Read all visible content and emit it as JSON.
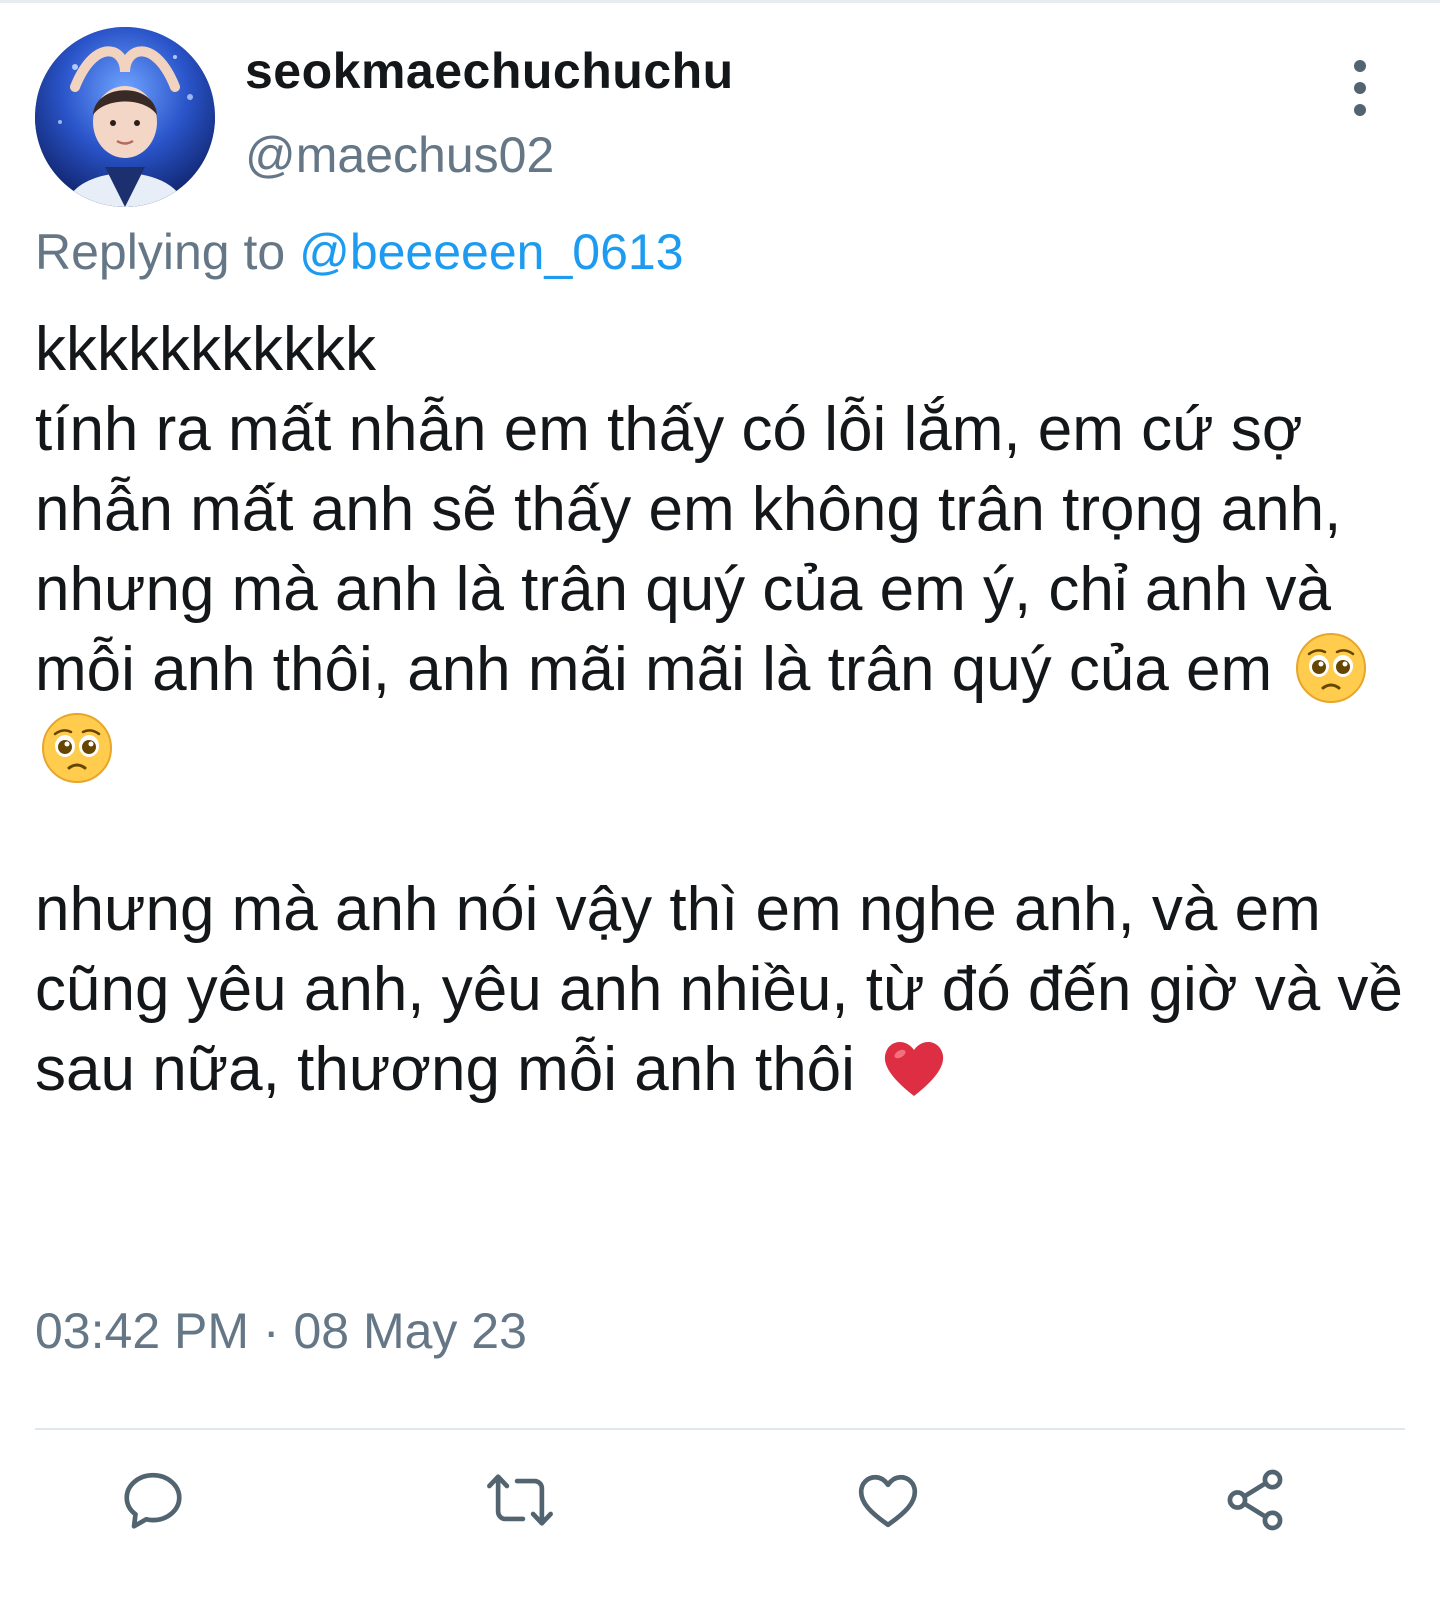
{
  "tweet": {
    "display_name": "seokmaechuchuchu",
    "handle": "@maechus02",
    "replying_prefix": "Replying to",
    "replying_mention": "@beeeeen_0613",
    "text_part1": "kkkkkkkkkkk\ntính ra mất nhẫn em thấy có lỗi lắm, em cứ sợ nhẫn mất anh sẽ thấy em không trân trọng anh, nhưng mà anh là trân quý của em ý, chỉ anh và mỗi anh thôi, anh mãi mãi là trân quý của em",
    "text_part2": "\n\nnhưng mà anh nói vậy thì em nghe anh, và em cũng yêu anh, yêu anh nhiều, từ đó đến giờ và về sau nữa, thương mỗi anh thôi",
    "emojis": [
      "pleading-face-emoji",
      "pleading-face-emoji",
      "red-heart-emoji"
    ],
    "timestamp": "03:42 PM · 08 May 23"
  },
  "colors": {
    "text": "#14171a",
    "secondary": "#657786",
    "link": "#1d9bf0",
    "icon": "#536471",
    "divider": "#e1e8ed"
  },
  "action_icons": [
    "reply-icon",
    "retweet-icon",
    "like-icon",
    "share-icon"
  ]
}
